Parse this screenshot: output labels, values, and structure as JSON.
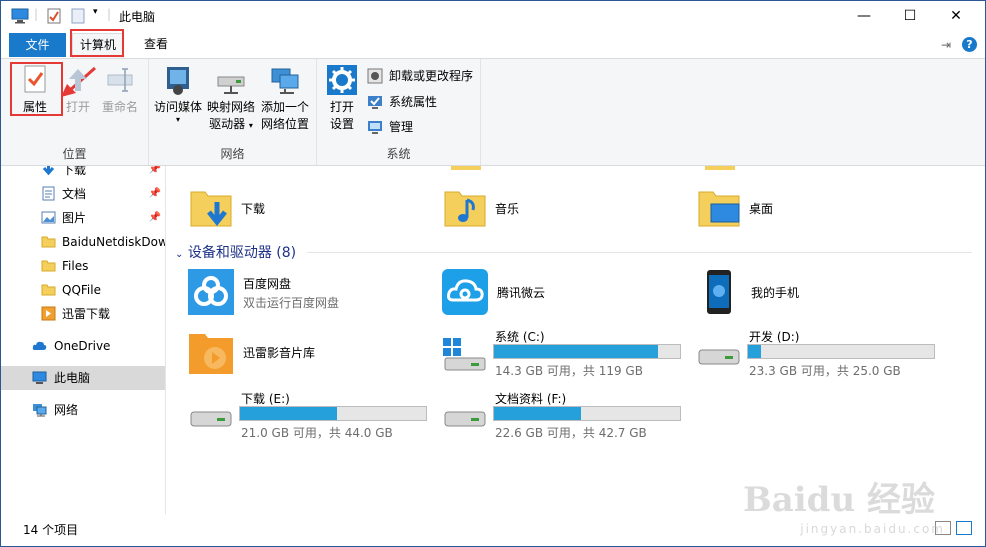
{
  "window": {
    "title": "此电脑",
    "minimize_glyph": "—",
    "maximize_glyph": "☐",
    "close_glyph": "✕"
  },
  "tabs": {
    "file": "文件",
    "computer": "计算机",
    "view": "查看"
  },
  "ribbon": {
    "location": {
      "label": "位置",
      "properties": "属性",
      "open": "打开",
      "rename": "重命名"
    },
    "network": {
      "label": "网络",
      "access_media": "访问媒体",
      "map_drive_1": "映射网络",
      "map_drive_2": "驱动器",
      "add_location_1": "添加一个",
      "add_location_2": "网络位置"
    },
    "system": {
      "label": "系统",
      "open_settings_1": "打开",
      "open_settings_2": "设置",
      "uninstall": "卸载或更改程序",
      "system_properties": "系统属性",
      "manage": "管理"
    }
  },
  "nav": {
    "items": [
      {
        "label": "下载",
        "icon": "download-arrow-icon",
        "pinned": true
      },
      {
        "label": "文档",
        "icon": "document-icon",
        "pinned": true
      },
      {
        "label": "图片",
        "icon": "picture-icon",
        "pinned": true
      },
      {
        "label": "BaiduNetdiskDow",
        "icon": "folder-icon",
        "pinned": false
      },
      {
        "label": "Files",
        "icon": "folder-icon",
        "pinned": false
      },
      {
        "label": "QQFile",
        "icon": "folder-icon",
        "pinned": false
      },
      {
        "label": "迅雷下载",
        "icon": "xunlei-folder-icon",
        "pinned": false
      },
      {
        "label": "OneDrive",
        "icon": "cloud-icon",
        "pinned": false
      },
      {
        "label": "此电脑",
        "icon": "computer-icon",
        "pinned": false
      },
      {
        "label": "网络",
        "icon": "network-icon",
        "pinned": false
      }
    ]
  },
  "content": {
    "folders": [
      {
        "label": "下载",
        "icon": "download-folder-icon"
      },
      {
        "label": "音乐",
        "icon": "music-folder-icon"
      },
      {
        "label": "桌面",
        "icon": "desktop-folder-icon"
      }
    ],
    "section_title": "设备和驱动器 (8)",
    "devices": [
      {
        "label": "百度网盘",
        "sub": "双击运行百度网盘",
        "icon": "baidu-netdisk-icon"
      },
      {
        "label": "腾讯微云",
        "icon": "weiyun-icon"
      },
      {
        "label": "我的手机",
        "icon": "phone-icon"
      },
      {
        "label": "迅雷影音片库",
        "icon": "xunlei-media-icon"
      }
    ],
    "drives": [
      {
        "label": "系统 (C:)",
        "free": "14.3 GB 可用，共 119 GB",
        "used_fraction": 0.88,
        "icon": "windows-drive-icon"
      },
      {
        "label": "开发 (D:)",
        "free": "23.3 GB 可用，共 25.0 GB",
        "used_fraction": 0.07,
        "icon": "drive-icon"
      },
      {
        "label": "下载 (E:)",
        "free": "21.0 GB 可用，共 44.0 GB",
        "used_fraction": 0.52,
        "icon": "drive-icon"
      },
      {
        "label": "文档资料 (F:)",
        "free": "22.6 GB 可用，共 42.7 GB",
        "used_fraction": 0.47,
        "icon": "drive-icon"
      }
    ]
  },
  "status": {
    "count": "14 个项目"
  },
  "watermark": {
    "main": "Baidu 经验",
    "sub": "jingyan.baidu.com"
  },
  "colors": {
    "accent": "#1979ca",
    "bar": "#26a0da",
    "highlight": "#e53935",
    "section": "#1e3287"
  }
}
